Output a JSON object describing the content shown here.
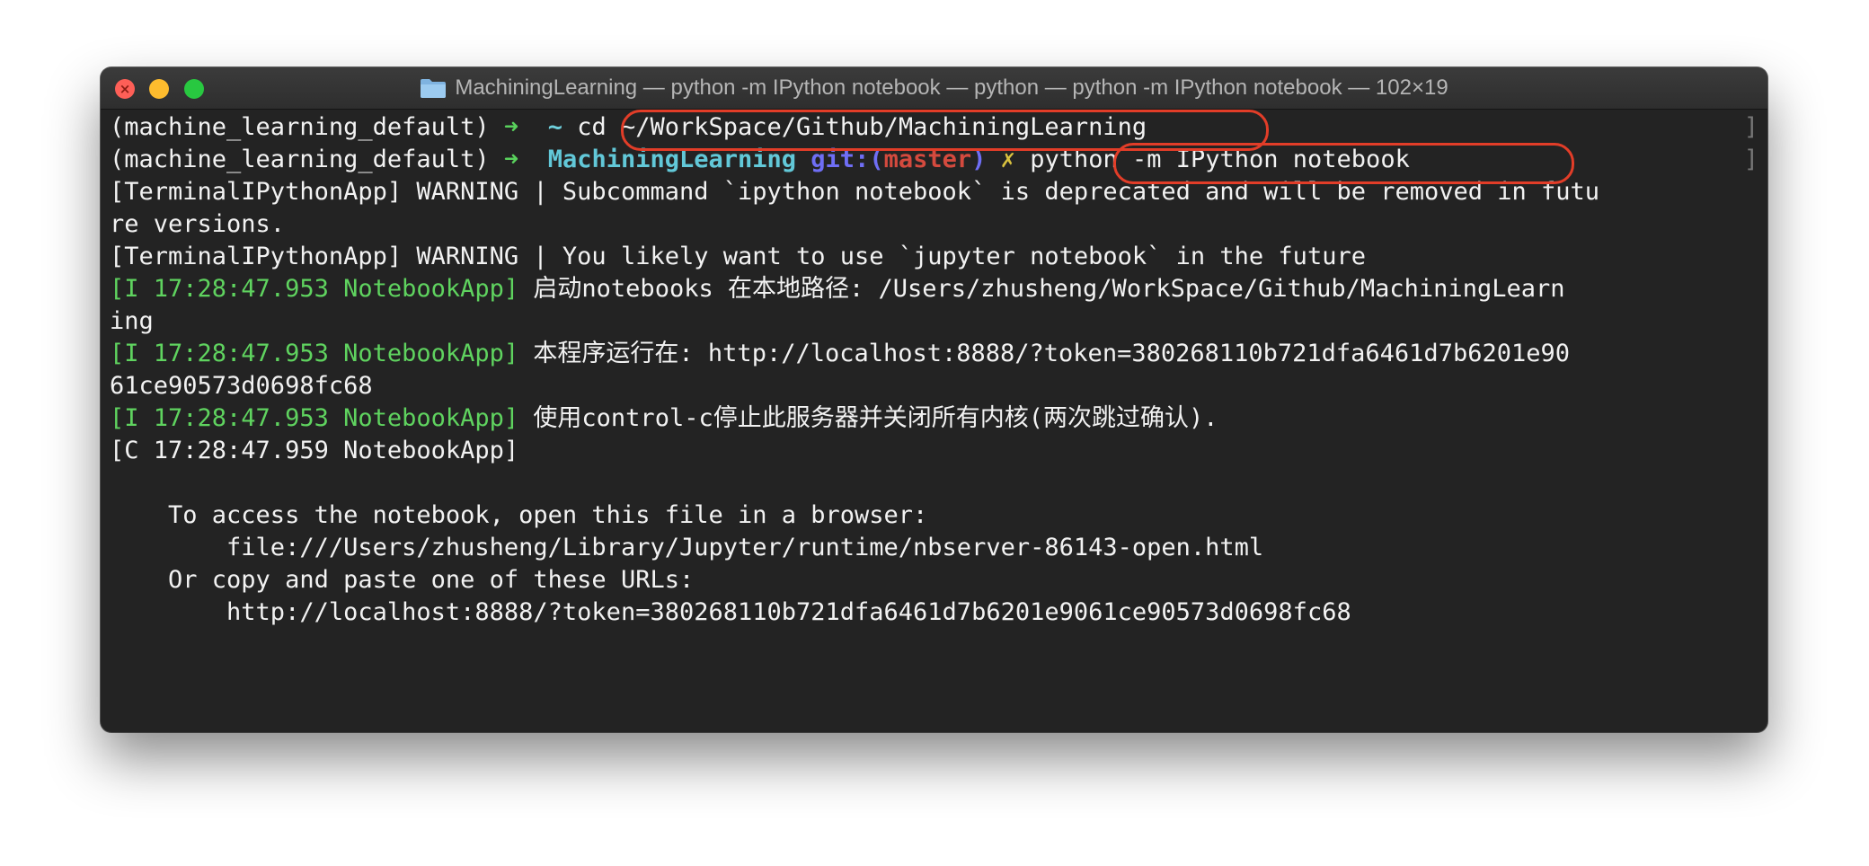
{
  "window": {
    "title": "MachiningLearning — python -m IPython notebook — python — python -m IPython notebook — 102×19",
    "icons": {
      "close": "close-icon",
      "minimize": "minimize-icon",
      "zoom": "zoom-icon",
      "folder": "folder-icon"
    }
  },
  "prompt": {
    "env": "(machine_learning_default)",
    "arrow": "➜",
    "home_dir": "~",
    "cmd1": "cd ~/WorkSpace/Github/MachiningLearning",
    "repo_dir": "MachiningLearning",
    "git_label": "git:(",
    "branch": "master",
    "git_close": ")",
    "dirty_mark": "✗",
    "cmd2": "python -m IPython notebook",
    "edge_mark": "]"
  },
  "output": {
    "warn1_a": "[TerminalIPythonApp] WARNING | Subcommand `ipython notebook` is deprecated and will be removed in futu",
    "warn1_b": "re versions.",
    "warn2": "[TerminalIPythonApp] WARNING | You likely want to use `jupyter notebook` in the future",
    "info_prefix": "[I 17:28:47.953 NotebookApp]",
    "info1_a": " 启动notebooks 在本地路径: /Users/zhusheng/WorkSpace/Github/MachiningLearn",
    "info1_b": "ing",
    "info2_a": " 本程序运行在: http://localhost:8888/?token=380268110b721dfa6461d7b6201e90",
    "info2_b": "61ce90573d0698fc68",
    "info3": " 使用control-c停止此服务器并关闭所有内核(两次跳过确认).",
    "crit": "[C 17:28:47.959 NotebookApp]",
    "access1": "    To access the notebook, open this file in a browser:",
    "access2": "        file:///Users/zhusheng/Library/Jupyter/runtime/nbserver-86143-open.html",
    "access3": "    Or copy and paste one of these URLs:",
    "access4": "        http://localhost:8888/?token=380268110b721dfa6461d7b6201e9061ce90573d0698fc68"
  },
  "colors": {
    "background": "#232323",
    "green": "#5fd35f",
    "cyan": "#62c8d8",
    "purple": "#6f6ef5",
    "red": "#d44a3e",
    "highlight": "#e23d28"
  }
}
